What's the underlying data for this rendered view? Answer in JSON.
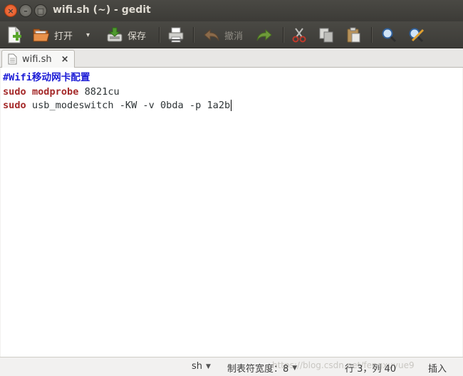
{
  "window": {
    "title": "wifi.sh (~) - gedit",
    "close_glyph": "×",
    "min_glyph": "–",
    "max_glyph": "□"
  },
  "toolbar": {
    "new_label": "",
    "open_label": "打开",
    "open_dropdown": "▾",
    "save_label": "保存",
    "undo_label": "撤消"
  },
  "tab": {
    "name": "wifi.sh",
    "close": "×"
  },
  "editor": {
    "line1": {
      "comment": "#Wifi移动网卡配置"
    },
    "line2": {
      "kw1": "sudo",
      "sp1": " ",
      "kw2": "modprobe",
      "rest": " 8821cu"
    },
    "line3": {
      "kw1": "sudo",
      "rest": " usb_modeswitch -KW -v 0bda -p 1a2b"
    }
  },
  "statusbar": {
    "language": "sh",
    "tab_width": "制表符宽度：8",
    "position": "行 3，列 40",
    "mode": "插入",
    "watermark": "https://blog.csdn.net/fengxuyue9"
  },
  "colors": {
    "comment": "#1c1cd6",
    "keyword": "#a52a2a",
    "titlebar": "#3c3b37",
    "close_button": "#e2531c"
  }
}
